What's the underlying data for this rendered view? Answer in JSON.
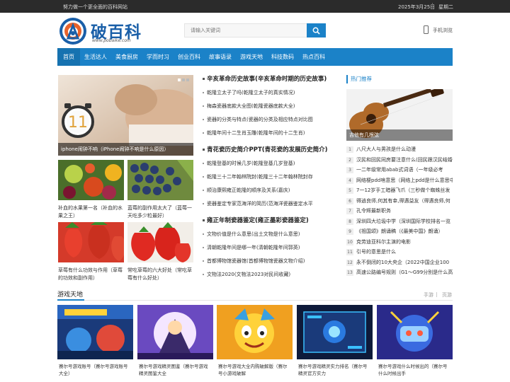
{
  "topbar": {
    "slogan": "努力做一个更全面的百科网站",
    "date": "2025年3月25日",
    "weekday": "星期二"
  },
  "header": {
    "logo_text": "破百科",
    "logo_url": "www.pobaike.com",
    "search_placeholder": "请输入关键词",
    "mobile_label": "手机浏览"
  },
  "nav": [
    "首页",
    "生活达人",
    "美食厨房",
    "学而时习",
    "创业百科",
    "故事语录",
    "游戏天地",
    "科技数码",
    "热点百科"
  ],
  "slider": {
    "caption": "iphone闹钟不响（iPhone闹钟不响是什么原因）",
    "badge": "11"
  },
  "tiles": [
    {
      "caption": "补血的水果第一名（补血的水果之王）"
    },
    {
      "caption": "蓝莓的副作用太大了（蓝莓一天吃多少粒最好）"
    },
    {
      "caption": "草莓有什么功效与作用（草莓的功效和副作用）"
    },
    {
      "caption": "常吃草莓的六大好处（常吃草莓有什么好处）"
    }
  ],
  "sections": [
    {
      "title": "辛亥革命历史故事(辛亥革命时期的历史故事)",
      "items": [
        "乾隆立太子了吗(乾隆立太子的真实情况)",
        "梅森瓷器底款大全图(乾隆瓷器底款大全)",
        "瓷器的分类与特点(瓷器的分类及相应特点对比图",
        "乾隆年间十二生肖玉雕(乾隆年间的十二生肖)"
      ]
    },
    {
      "title": "青花瓷历史简介PPT(青花瓷的发展历史简介)",
      "items": [
        "乾隆登基的时候几岁(乾隆登基几岁登基)",
        "乾隆三十二年翰林院封(乾隆三十二年翰林院封存",
        "顺治康熙雍正乾隆的顺序及关系(嘉庆)",
        "瓷器鉴定专家范海洋的简历(范海洋瓷器鉴定水平"
      ]
    },
    {
      "title": "雍正年制瓷器鉴定(雍正墨彩瓷器鉴定)",
      "items": [
        "文物价值是什么意思(出土文物是什么意思)",
        "清朝乾隆年间是哪一年(清朝乾隆年间郭英)",
        "首都博物馆瓷器馆(首都博物馆瓷器文物介绍)",
        "文物法2020(文物法2023对民间收藏)"
      ]
    }
  ],
  "hot": {
    "title": "热门推荐",
    "feature_caption": "吉他有几根弦",
    "items": [
      "八尺大人与男孩是什么动漫",
      "汉民和回民同房要注意什么(回民跟汉民结婚",
      "一二年级常用abab式词语（一年级必考",
      "网络梗pdd啥意思（网络上pdd是什么意思中",
      "7一12岁手工暗器飞爪（三秒做个蜘蛛丝发",
      "得逍良师,何其有幸,得遇益友（得遇良师,何",
      "孔令辉最新职务",
      "深圳四大垃圾中学（深圳国际学校排名一览",
      "《祖国颂》朗诵稿（《最美中国》朗诵）",
      "克劳迪亚科尔主演的电影",
      "引号的意思是什么",
      "永不倒闭的10大央企（2022中国企业100",
      "高速公路编号规则（G1～G99分别是什么高"
    ]
  },
  "games": {
    "title": "游戏天地",
    "link_left": "手游",
    "link_right": "页游",
    "items": [
      {
        "caption": "赛尔号游戏账号（赛尔号游戏账号大全）"
      },
      {
        "caption": "赛尔号游戏精灵图鉴（赛尔号游戏精灵图鉴大全"
      },
      {
        "caption": "赛尔号游戏大全内购破解版（赛尔号小游戏破解"
      },
      {
        "caption": "赛尔号游戏精灵实力排名（赛尔号精灵官方实力"
      },
      {
        "caption": "赛尔号游戏什么时候出的（赛尔号什么时候出手"
      }
    ]
  },
  "colors": {
    "accent": "#1b82c8",
    "topbar": "#2b2b2b"
  }
}
